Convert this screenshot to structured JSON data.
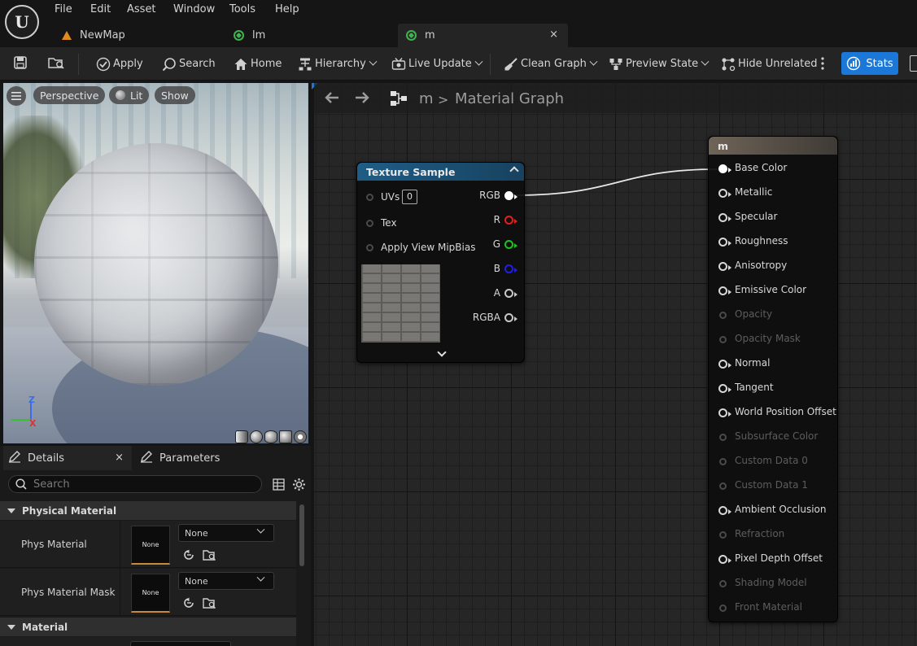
{
  "app": {
    "logo_letter": "U",
    "menu": [
      "File",
      "Edit",
      "Asset",
      "Window",
      "Tools",
      "Help"
    ],
    "tabs": [
      {
        "label": "NewMap",
        "icon": "level-icon"
      },
      {
        "label": "lm",
        "icon": "material-icon"
      },
      {
        "label": "m",
        "icon": "material-icon",
        "close": "×"
      }
    ]
  },
  "toolbar": {
    "apply": "Apply",
    "search": "Search",
    "home": "Home",
    "hierarchy": "Hierarchy",
    "live_update": "Live Update",
    "clean_graph": "Clean Graph",
    "preview_state": "Preview State",
    "hide_unrelated": "Hide Unrelated",
    "stats": "Stats"
  },
  "viewport": {
    "perspective": "Perspective",
    "lit": "Lit",
    "show": "Show",
    "axis_z": "Z",
    "axis_x": "X"
  },
  "details": {
    "tab_details": "Details",
    "tab_details_close": "×",
    "tab_parameters": "Parameters",
    "search_placeholder": "Search",
    "category_physical": "Physical Material",
    "phys_material_label": "Phys Material",
    "phys_material_thumb": "None",
    "phys_material_value": "None",
    "phys_mask_label": "Phys Material Mask",
    "phys_mask_thumb": "None",
    "phys_mask_value": "None",
    "category_material": "Material"
  },
  "graph": {
    "crumb_root": "m",
    "crumb_sep": ">",
    "crumb_current": "Material Graph"
  },
  "texture_node": {
    "title": "Texture Sample",
    "uvs_label": "UVs",
    "uvs_value": "0",
    "inputs": [
      "Tex",
      "Apply View MipBias"
    ],
    "outputs": [
      {
        "label": "RGB",
        "color": "#ffffff"
      },
      {
        "label": "R",
        "color": "#e02020"
      },
      {
        "label": "G",
        "color": "#20c020"
      },
      {
        "label": "B",
        "color": "#2020e0"
      },
      {
        "label": "A",
        "color": "#c8c8c8"
      },
      {
        "label": "RGBA",
        "color": "#c8c8c8"
      }
    ],
    "expand_icon": "chevron-down-icon"
  },
  "material_node": {
    "title": "m",
    "inputs": [
      {
        "label": "Base Color",
        "enabled": true,
        "connected": true
      },
      {
        "label": "Metallic",
        "enabled": true
      },
      {
        "label": "Specular",
        "enabled": true
      },
      {
        "label": "Roughness",
        "enabled": true
      },
      {
        "label": "Anisotropy",
        "enabled": true
      },
      {
        "label": "Emissive Color",
        "enabled": true
      },
      {
        "label": "Opacity",
        "enabled": false
      },
      {
        "label": "Opacity Mask",
        "enabled": false
      },
      {
        "label": "Normal",
        "enabled": true
      },
      {
        "label": "Tangent",
        "enabled": true
      },
      {
        "label": "World Position Offset",
        "enabled": true
      },
      {
        "label": "Subsurface Color",
        "enabled": false
      },
      {
        "label": "Custom Data 0",
        "enabled": false
      },
      {
        "label": "Custom Data 1",
        "enabled": false
      },
      {
        "label": "Ambient Occlusion",
        "enabled": true
      },
      {
        "label": "Refraction",
        "enabled": false
      },
      {
        "label": "Pixel Depth Offset",
        "enabled": true
      },
      {
        "label": "Shading Model",
        "enabled": false
      },
      {
        "label": "Front Material",
        "enabled": false
      }
    ]
  },
  "colors": {
    "accent_blue": "#1b78d8",
    "texture_header": "#1f5d86",
    "result_header": "#6f6458"
  }
}
